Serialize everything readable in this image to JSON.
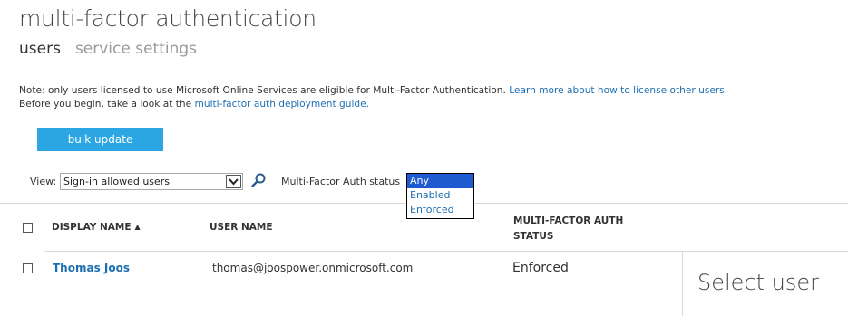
{
  "header": {
    "title": "multi-factor authentication",
    "tabs": [
      {
        "label": "users",
        "active": true
      },
      {
        "label": "service settings",
        "active": false
      }
    ]
  },
  "note": {
    "line1_text": "Note: only users licensed to use Microsoft Online Services are eligible for Multi-Factor Authentication.",
    "line1_link": "Learn more about how to license other users.",
    "line2_text": "Before you begin, take a look at the",
    "line2_link": "multi-factor auth deployment guide."
  },
  "bulk_update_label": "bulk update",
  "filters": {
    "view_label": "View:",
    "view_value": "Sign-in allowed users",
    "mfa_status_label": "Multi-Factor Auth status",
    "mfa_status_options": [
      "Any",
      "Enabled",
      "Enforced"
    ],
    "mfa_status_selected": "Any"
  },
  "table": {
    "columns": {
      "display_name": "DISPLAY NAME",
      "user_name": "USER NAME",
      "mfa_status_line1": "MULTI-FACTOR AUTH",
      "mfa_status_line2": "STATUS"
    },
    "rows": [
      {
        "display_name": "Thomas Joos",
        "user_name": "thomas@joospower.onmicrosoft.com",
        "mfa_status": "Enforced"
      }
    ]
  },
  "detail_panel": {
    "text": "Select user"
  },
  "colors": {
    "link": "#1e6fb2",
    "button": "#2ba6e3",
    "dropdown_highlight": "#1e5bd0"
  }
}
